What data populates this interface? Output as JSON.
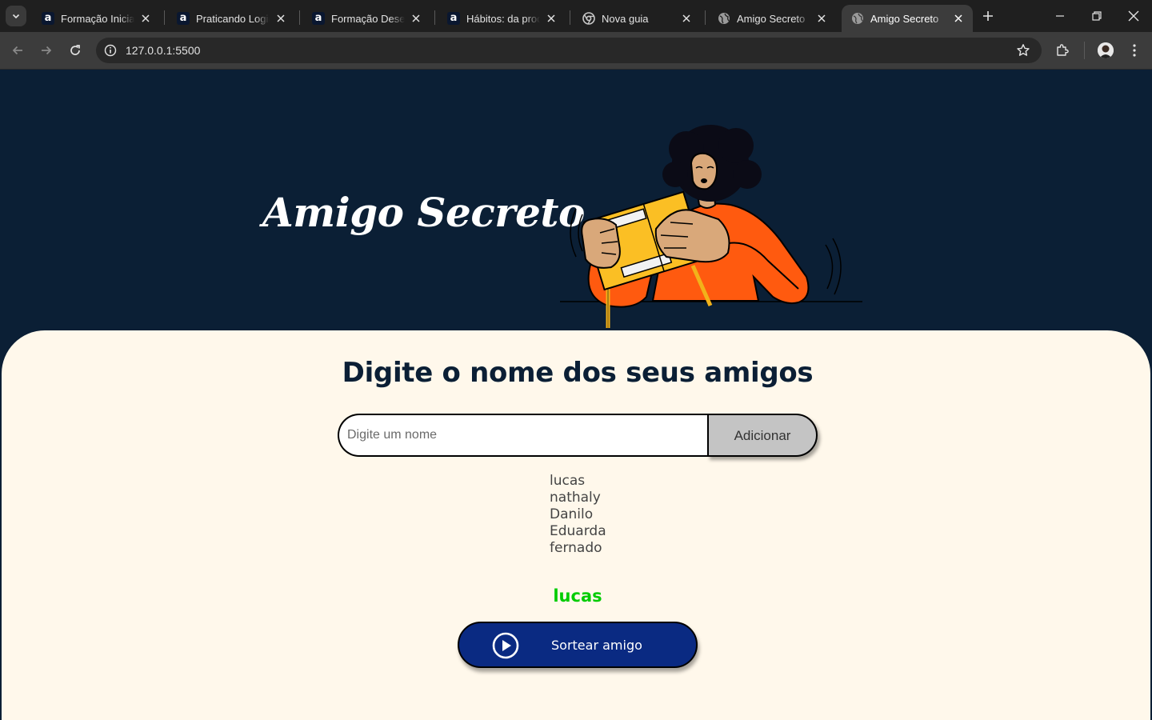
{
  "browser": {
    "tabs": [
      {
        "title": "Formação Iniciante",
        "favicon": "alura-icon",
        "active": false
      },
      {
        "title": "Praticando Logica",
        "favicon": "alura-icon",
        "active": false
      },
      {
        "title": "Formação Desenvolvedor",
        "favicon": "alura-icon",
        "active": false
      },
      {
        "title": "Hábitos: da produtividade",
        "favicon": "alura-icon",
        "active": false
      },
      {
        "title": "Nova guia",
        "favicon": "chrome-icon",
        "active": false
      },
      {
        "title": "Amigo Secreto",
        "favicon": "globe-icon",
        "active": false
      },
      {
        "title": "Amigo Secreto",
        "favicon": "globe-icon",
        "active": true
      }
    ],
    "url": "127.0.0.1:5500",
    "favicon_letter": "a"
  },
  "hero": {
    "title": "Amigo Secreto"
  },
  "main": {
    "section_title": "Digite o nome dos seus amigos",
    "input_placeholder": "Digite um nome",
    "input_value": "",
    "add_button_label": "Adicionar",
    "friends": [
      "lucas",
      "nathaly",
      "Danilo",
      "Eduarda",
      "fernado"
    ],
    "result": "lucas",
    "draw_button_label": "Sortear amigo"
  },
  "colors": {
    "header_bg": "#0b1f35",
    "panel_bg": "#fff8eb",
    "button_primary": "#0a2a82",
    "button_secondary": "#c4c4c4",
    "result_text": "#00cc00"
  }
}
